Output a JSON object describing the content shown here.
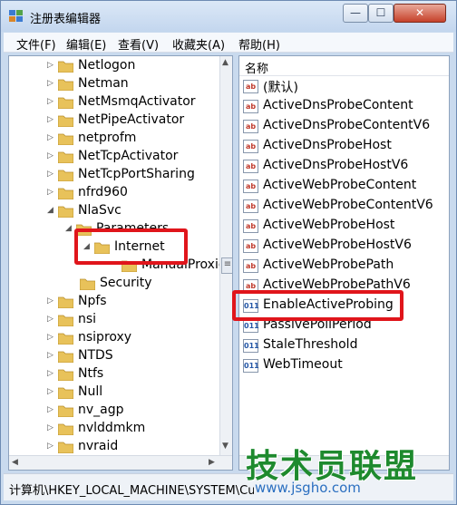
{
  "window": {
    "title": "注册表编辑器",
    "controls": {
      "minimize": "—",
      "maximize": "☐",
      "close": "✕"
    }
  },
  "menu": [
    "文件(F)",
    "编辑(E)",
    "查看(V)",
    "收藏夹(A)",
    "帮助(H)"
  ],
  "tree": {
    "items": [
      {
        "label": "Netlogon",
        "arrow": "▷"
      },
      {
        "label": "Netman",
        "arrow": "▷"
      },
      {
        "label": "NetMsmqActivator",
        "arrow": "▷"
      },
      {
        "label": "NetPipeActivator",
        "arrow": "▷"
      },
      {
        "label": "netprofm",
        "arrow": "▷"
      },
      {
        "label": "NetTcpActivator",
        "arrow": "▷"
      },
      {
        "label": "NetTcpPortSharing",
        "arrow": "▷"
      },
      {
        "label": "nfrd960",
        "arrow": "▷"
      },
      {
        "label": "NlaSvc",
        "arrow": "◢"
      },
      {
        "label": "Parameters",
        "arrow": "◢"
      },
      {
        "label": "Internet",
        "arrow": "◢"
      },
      {
        "label": "ManualProxies",
        "arrow": ""
      },
      {
        "label": "Security",
        "arrow": ""
      },
      {
        "label": "Npfs",
        "arrow": "▷"
      },
      {
        "label": "nsi",
        "arrow": "▷"
      },
      {
        "label": "nsiproxy",
        "arrow": "▷"
      },
      {
        "label": "NTDS",
        "arrow": "▷"
      },
      {
        "label": "Ntfs",
        "arrow": "▷"
      },
      {
        "label": "Null",
        "arrow": "▷"
      },
      {
        "label": "nv_agp",
        "arrow": "▷"
      },
      {
        "label": "nvlddmkm",
        "arrow": "▷"
      },
      {
        "label": "nvraid",
        "arrow": "▷"
      }
    ],
    "scroll": {
      "up": "▲",
      "down": "▼",
      "left": "◀",
      "right": "▶",
      "thumb": "≡"
    }
  },
  "list": {
    "header": "名称",
    "values": [
      {
        "label": "(默认)",
        "type": "str",
        "icon": "ab"
      },
      {
        "label": "ActiveDnsProbeContent",
        "type": "str",
        "icon": "ab"
      },
      {
        "label": "ActiveDnsProbeContentV6",
        "type": "str",
        "icon": "ab"
      },
      {
        "label": "ActiveDnsProbeHost",
        "type": "str",
        "icon": "ab"
      },
      {
        "label": "ActiveDnsProbeHostV6",
        "type": "str",
        "icon": "ab"
      },
      {
        "label": "ActiveWebProbeContent",
        "type": "str",
        "icon": "ab"
      },
      {
        "label": "ActiveWebProbeContentV6",
        "type": "str",
        "icon": "ab"
      },
      {
        "label": "ActiveWebProbeHost",
        "type": "str",
        "icon": "ab"
      },
      {
        "label": "ActiveWebProbeHostV6",
        "type": "str",
        "icon": "ab"
      },
      {
        "label": "ActiveWebProbePath",
        "type": "str",
        "icon": "ab"
      },
      {
        "label": "ActiveWebProbePathV6",
        "type": "str",
        "icon": "ab"
      },
      {
        "label": "EnableActiveProbing",
        "type": "num",
        "icon": "011"
      },
      {
        "label": "PassivePollPeriod",
        "type": "num",
        "icon": "011"
      },
      {
        "label": "StaleThreshold",
        "type": "num",
        "icon": "011"
      },
      {
        "label": "WebTimeout",
        "type": "num",
        "icon": "011"
      }
    ]
  },
  "status": {
    "path": "计算机\\HKEY_LOCAL_MACHINE\\SYSTEM\\CurrentControlSet"
  },
  "watermark": {
    "title": "技术员联盟",
    "url": "www.jsgho.com"
  },
  "colors": {
    "highlight": "#e0151b",
    "folder": "#e8c25a",
    "watermark_green": "#1e8a2e",
    "watermark_blue": "#2b6fc0"
  }
}
